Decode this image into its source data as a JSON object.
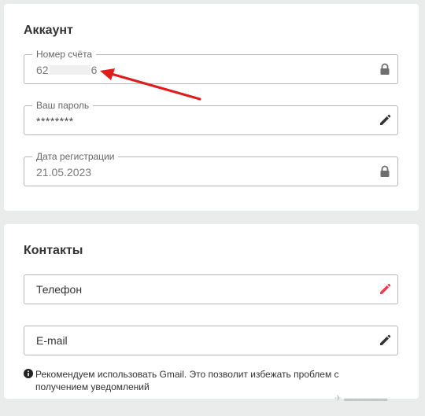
{
  "account": {
    "title": "Аккаунт",
    "fields": {
      "account_number": {
        "label": "Номер счёта",
        "value_prefix": "62",
        "value_suffix": "6",
        "icon": "lock-icon"
      },
      "password": {
        "label": "Ваш пароль",
        "value": "********",
        "icon": "pencil-icon"
      },
      "registration_date": {
        "label": "Дата регистрации",
        "value": "21.05.2023",
        "icon": "lock-icon"
      }
    }
  },
  "contacts": {
    "title": "Контакты",
    "phone": {
      "placeholder": "Телефон",
      "icon": "pencil-icon",
      "icon_color": "#e8414d"
    },
    "email": {
      "placeholder": "E-mail",
      "icon": "pencil-icon"
    },
    "note": "Рекомендуем использовать Gmail. Это позволит избежать проблем с получением уведомлений"
  },
  "annotation": {
    "arrow_color": "#e01b1b"
  },
  "colors": {
    "background": "#e9ecea",
    "card": "#ffffff",
    "border": "#b6b6b6",
    "icon": "#333333"
  }
}
